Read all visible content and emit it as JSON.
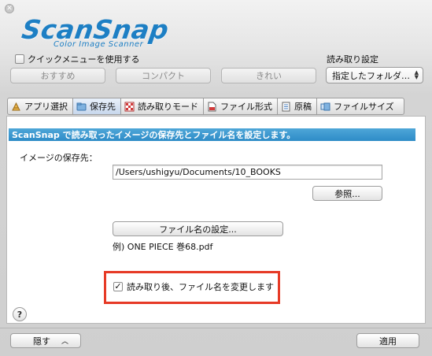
{
  "window": {
    "close_icon": "close-icon"
  },
  "header": {
    "logo_main": "ScanSnap",
    "logo_sub": "Color Image Scanner",
    "quick_menu_label": "クイックメニューを使用する",
    "quick_menu_checked": false,
    "read_setting_label": "読み取り設定",
    "presets": [
      "おすすめ",
      "コンパクト",
      "きれい"
    ],
    "read_setting_value": "指定したフォルダ…"
  },
  "tabs": [
    {
      "label": "アプリ選択",
      "icon": "app-icon"
    },
    {
      "label": "保存先",
      "icon": "folder-icon"
    },
    {
      "label": "読み取りモード",
      "icon": "scan-mode-icon"
    },
    {
      "label": "ファイル形式",
      "icon": "file-format-icon"
    },
    {
      "label": "原稿",
      "icon": "document-icon"
    },
    {
      "label": "ファイルサイズ",
      "icon": "file-size-icon"
    }
  ],
  "active_tab": "保存先",
  "panel": {
    "banner": "ScanSnap で読み取ったイメージの保存先とファイル名を設定します。",
    "dest_label": "イメージの保存先：",
    "path_value": "/Users/ushigyu/Documents/10_BOOKS",
    "browse_button": "参照...",
    "filename_button": "ファイル名の設定...",
    "example": "例) ONE PIECE 巻68.pdf",
    "rename_label": "読み取り後、ファイル名を変更します",
    "rename_checked": true
  },
  "footer": {
    "help": "?",
    "hide_button": "隠す",
    "hide_icon": "chevron-up-icon",
    "apply_button": "適用"
  },
  "colors": {
    "brand_blue": "#1d7fc4",
    "banner_blue": "#2e8cc7",
    "highlight_red": "#e63a26"
  }
}
